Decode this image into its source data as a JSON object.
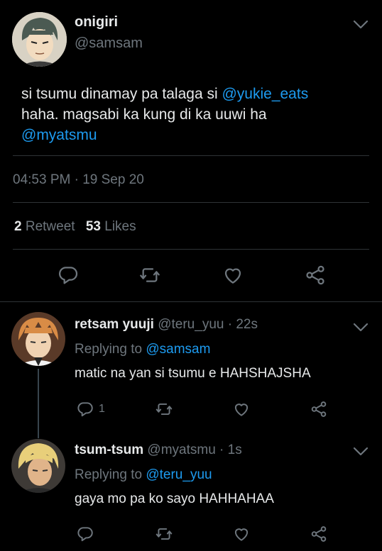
{
  "tweet": {
    "display_name": "onigiri",
    "handle": "@samsam",
    "text_1": "si tsumu dinamay pa talaga si ",
    "mention_1": "@yukie_eats",
    "text_2": "haha. magsabi ka kung di ka uuwi ha",
    "mention_2": "@myatsmu",
    "time": "04:53 PM",
    "dot": "·",
    "date": "19 Sep 20",
    "retweet_count": "2",
    "retweet_label": "Retweet",
    "like_count": "53",
    "like_label": "Likes"
  },
  "replies": [
    {
      "display_name": "retsam yuuji",
      "handle": "@teru_yuu",
      "dot": "·",
      "time": "22s",
      "replying_label": "Replying to ",
      "replying_to": "@samsam",
      "text": "matic na yan si tsumu e HAHSHAJSHA",
      "reply_count": "1"
    },
    {
      "display_name": "tsum-tsum",
      "handle": "@myatsmu",
      "dot": "·",
      "time": "1s",
      "replying_label": "Replying to ",
      "replying_to": "@teru_yuu",
      "text": "gaya mo pa ko sayo HAHHAHAA"
    }
  ],
  "colors": {
    "background": "#000000",
    "accent": "#1d9bf0",
    "secondary": "#6e767d",
    "text": "#e7e9ea"
  },
  "icons": [
    "chevron-down-icon",
    "reply-icon",
    "retweet-icon",
    "like-icon",
    "share-icon"
  ]
}
